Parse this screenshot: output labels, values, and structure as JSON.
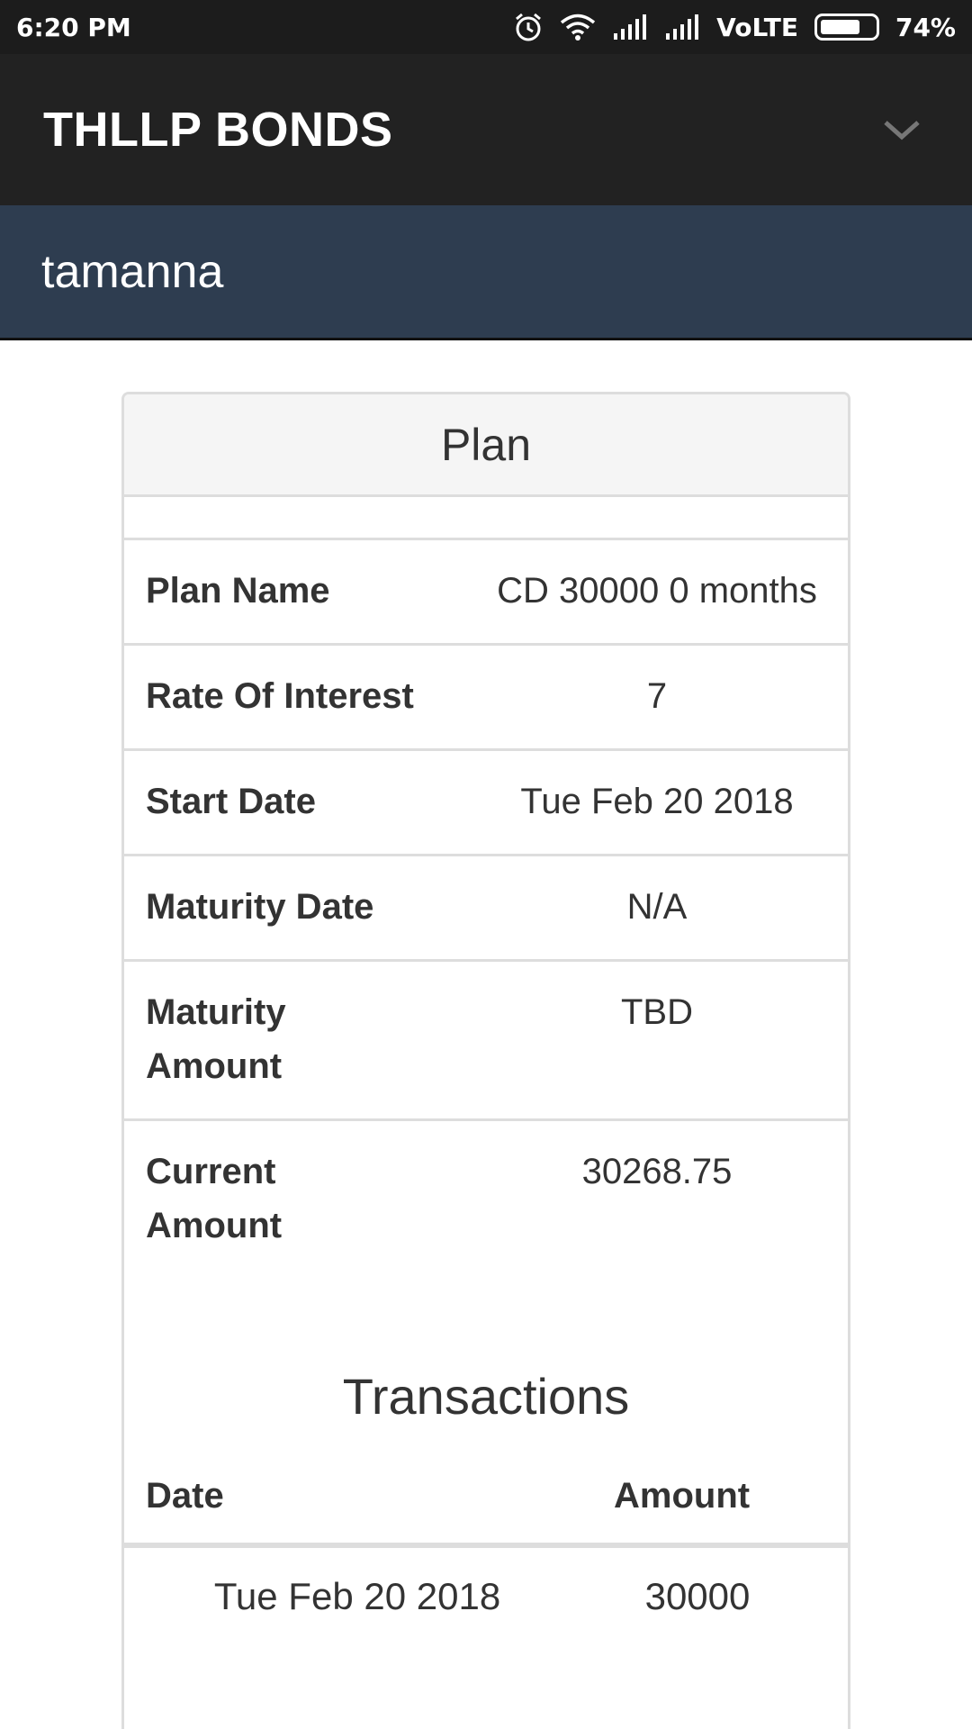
{
  "status_bar": {
    "time": "6:20 PM",
    "network": "VoLTE",
    "battery": "74%",
    "battery_level": 0.74,
    "icons": [
      "alarm-icon",
      "wifi-icon",
      "signal-icon",
      "signal-icon",
      "battery-icon"
    ]
  },
  "app_bar": {
    "title": "THLLP BONDS",
    "toggle_icon": "chevron-down-icon"
  },
  "user_bar": {
    "name": "tamanna"
  },
  "plan": {
    "heading": "Plan",
    "rows": [
      {
        "label": "Plan Name",
        "value": "CD 30000 0 months"
      },
      {
        "label": "Rate Of Interest",
        "value": "7"
      },
      {
        "label": "Start Date",
        "value": "Tue Feb 20 2018"
      },
      {
        "label": "Maturity Date",
        "value": "N/A"
      },
      {
        "label": "Maturity Amount",
        "value": "TBD"
      },
      {
        "label": "Current Amount",
        "value": "30268.75"
      }
    ]
  },
  "transactions": {
    "title": "Transactions",
    "columns": {
      "date": "Date",
      "amount": "Amount"
    },
    "rows": [
      {
        "date": "Tue Feb 20 2018",
        "amount": "30000"
      }
    ]
  },
  "colors": {
    "status_bar": "#1c1c1c",
    "app_bar": "#222222",
    "user_bar": "#2e3d50",
    "panel_heading": "#f5f5f5",
    "border": "#dddddd"
  }
}
